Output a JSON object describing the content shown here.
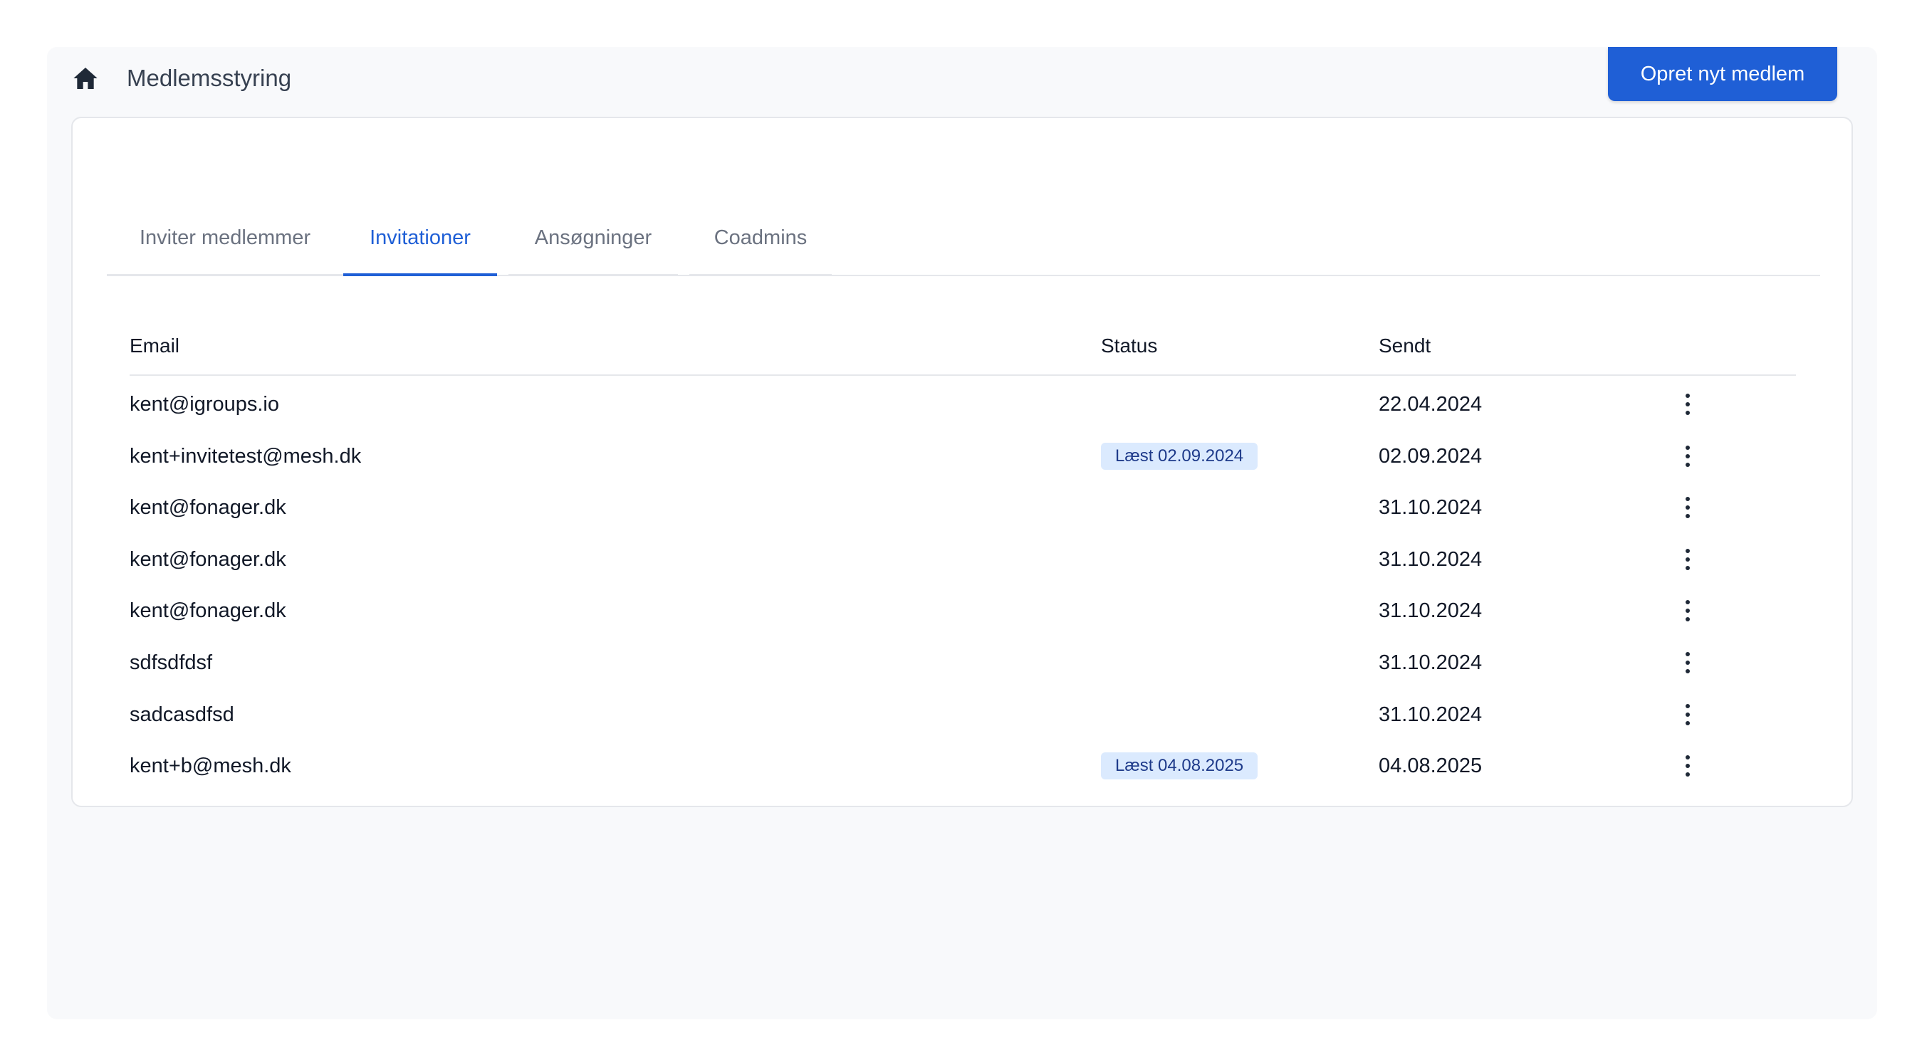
{
  "header": {
    "title": "Medlemsstyring",
    "create_button": "Opret nyt medlem"
  },
  "tabs": [
    {
      "label": "Inviter medlemmer",
      "active": false
    },
    {
      "label": "Invitationer",
      "active": true
    },
    {
      "label": "Ansøgninger",
      "active": false
    },
    {
      "label": "Coadmins",
      "active": false
    }
  ],
  "table": {
    "columns": {
      "email": "Email",
      "status": "Status",
      "sent": "Sendt"
    },
    "rows": [
      {
        "email": "kent@igroups.io",
        "status": "",
        "sent": "22.04.2024"
      },
      {
        "email": "kent+invitetest@mesh.dk",
        "status": "Læst 02.09.2024",
        "sent": "02.09.2024"
      },
      {
        "email": "kent@fonager.dk",
        "status": "",
        "sent": "31.10.2024"
      },
      {
        "email": "kent@fonager.dk",
        "status": "",
        "sent": "31.10.2024"
      },
      {
        "email": "kent@fonager.dk",
        "status": "",
        "sent": "31.10.2024"
      },
      {
        "email": "sdfsdfdsf",
        "status": "",
        "sent": "31.10.2024"
      },
      {
        "email": "sadcasdfsd",
        "status": "",
        "sent": "31.10.2024"
      },
      {
        "email": "kent+b@mesh.dk",
        "status": "Læst 04.08.2025",
        "sent": "04.08.2025"
      }
    ]
  },
  "colors": {
    "accent": "#1f5fd6",
    "badge_bg": "#dbeafe",
    "badge_text": "#1e3a8a"
  },
  "icons": {
    "home": "home-icon",
    "row_menu": "more-vertical-icon"
  }
}
